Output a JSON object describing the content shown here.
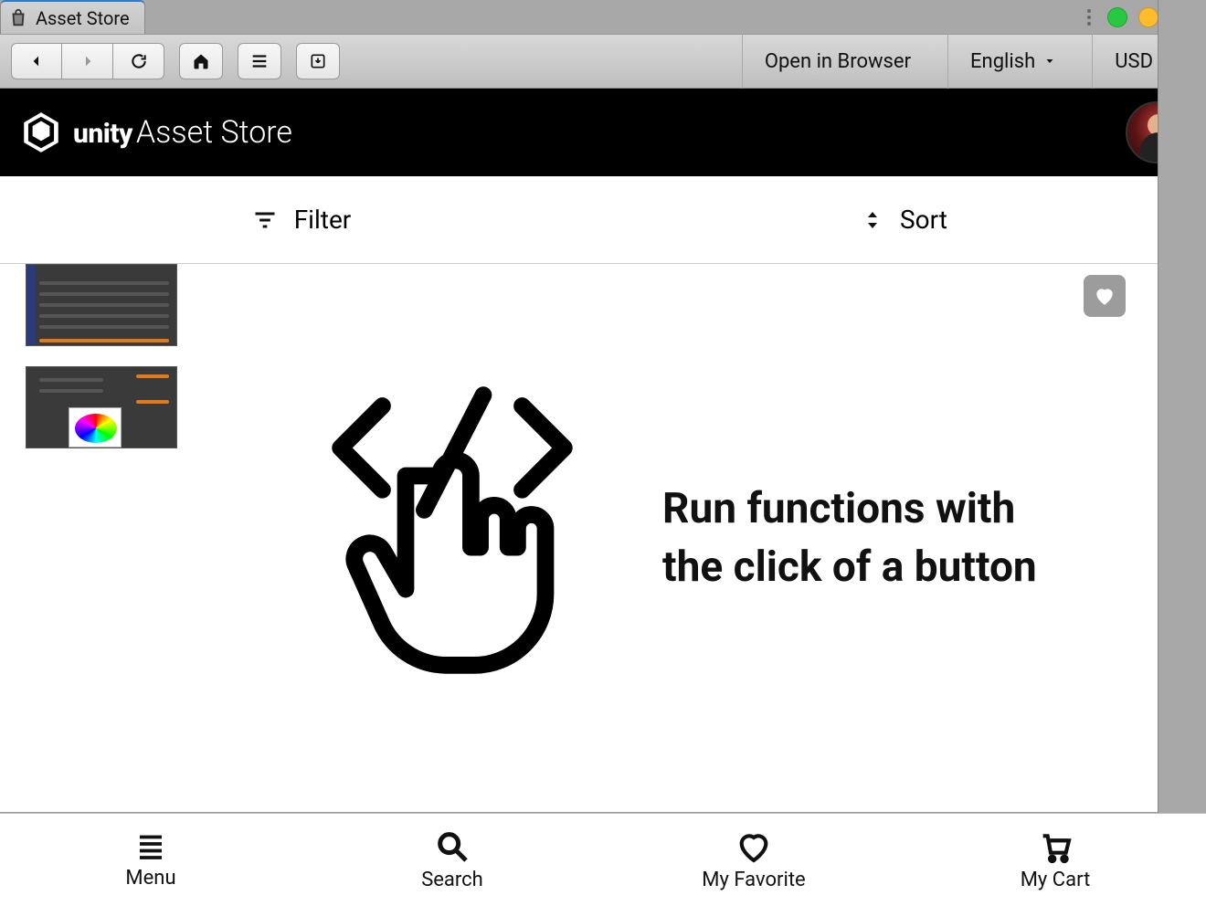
{
  "window": {
    "tab_title": "Asset Store"
  },
  "toolbar": {
    "open_in_browser": "Open in Browser",
    "language": "English",
    "currency": "USD"
  },
  "storeheader": {
    "brand_unity": "unity",
    "brand_asset": "Asset Store"
  },
  "controlbar": {
    "filter_label": "Filter",
    "sort_label": "Sort"
  },
  "preview": {
    "headline": "Run functions with the click of a button"
  },
  "bottomnav": {
    "menu": "Menu",
    "search": "Search",
    "favorite": "My Favorite",
    "cart": "My Cart"
  }
}
